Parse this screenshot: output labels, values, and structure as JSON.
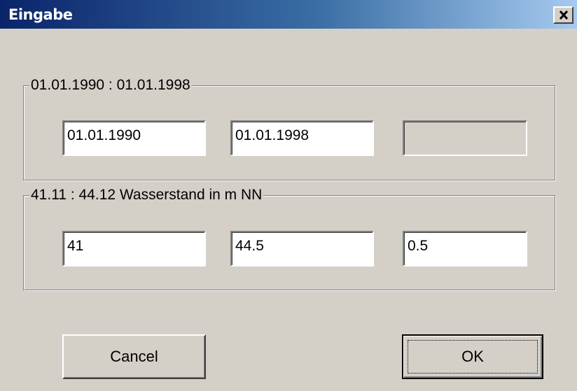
{
  "dialog": {
    "title": "Eingabe",
    "close_glyph": "✕"
  },
  "date_group": {
    "label": "01.01.1990 : 01.01.1998",
    "from": "01.01.1990",
    "to": "01.01.1998",
    "step": ""
  },
  "level_group": {
    "label": "41.11 : 44.12 Wasserstand in m NN",
    "from": "41",
    "to": "44.5",
    "step": "0.5"
  },
  "buttons": {
    "cancel": "Cancel",
    "ok": "OK"
  },
  "colors": {
    "title_start": "#0a246a",
    "title_end": "#a6caf0",
    "face": "#d4d0c8"
  }
}
